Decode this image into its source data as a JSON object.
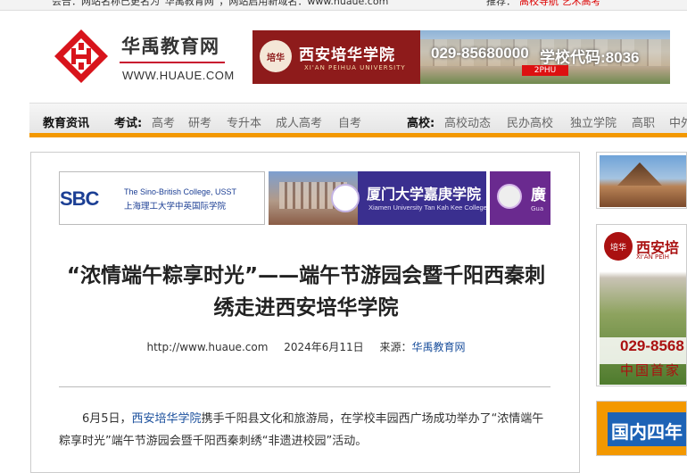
{
  "topbar": {
    "left_text": "会告：网站名称已更名为“华禹教育网”，网站启用新域名：www.huaue.com",
    "right_label": "推荐：",
    "right_links": "高校导航  艺术高考"
  },
  "header": {
    "site_name": "华禹教育网",
    "site_domain": "WWW.HUAUE.COM"
  },
  "top_banner": {
    "school_name": "西安培华学院",
    "school_en": "XI'AN PEIHUA UNIVERSITY",
    "seal_text": "培华",
    "phone": "029-85680000",
    "code": "学校代码:8036",
    "flag": "2PHU"
  },
  "nav": {
    "news": "教育资讯",
    "exam_label": "考试:",
    "exam_items": [
      "高考",
      "研考",
      "专升本",
      "成人高考",
      "自考"
    ],
    "college_label": "高校:",
    "college_items": [
      "高校动态",
      "民办高校",
      "独立学院",
      "高职",
      "中外"
    ]
  },
  "ads": {
    "sbc_logo": "SBC",
    "sbc_en": "The Sino-British College, USST",
    "sbc_cn": "上海理工大学中英国际学院",
    "xmu_cn": "厦门大学嘉庚学院",
    "xmu_en": "Xiamen University Tan Kah Kee College",
    "third_cn": "廣",
    "third_en": "Gua"
  },
  "article": {
    "title": "“浓情端午粽享时光”——端午节游园会暨千阳西秦刺绣走进西安培华学院",
    "url": "http://www.huaue.com",
    "date": "2024年6月11日",
    "source_label": "来源：",
    "source": "华禹教育网",
    "body_prefix": "6月5日，",
    "body_link": "西安培华学院",
    "body_rest": "携手千阳县文化和旅游局，在学校丰园西广场成功举办了“浓情端午粽享时光”端午节游园会暨千阳西秦刺绣“非遗进校园”活动。"
  },
  "sidebar": {
    "ad2_seal": "培华",
    "ad2_name": "西安培",
    "ad2_en": "XI'AN PEIH",
    "ad2_phone": "029-8568",
    "ad2_cn": "中国首家",
    "ad3_text": "国内四年"
  }
}
